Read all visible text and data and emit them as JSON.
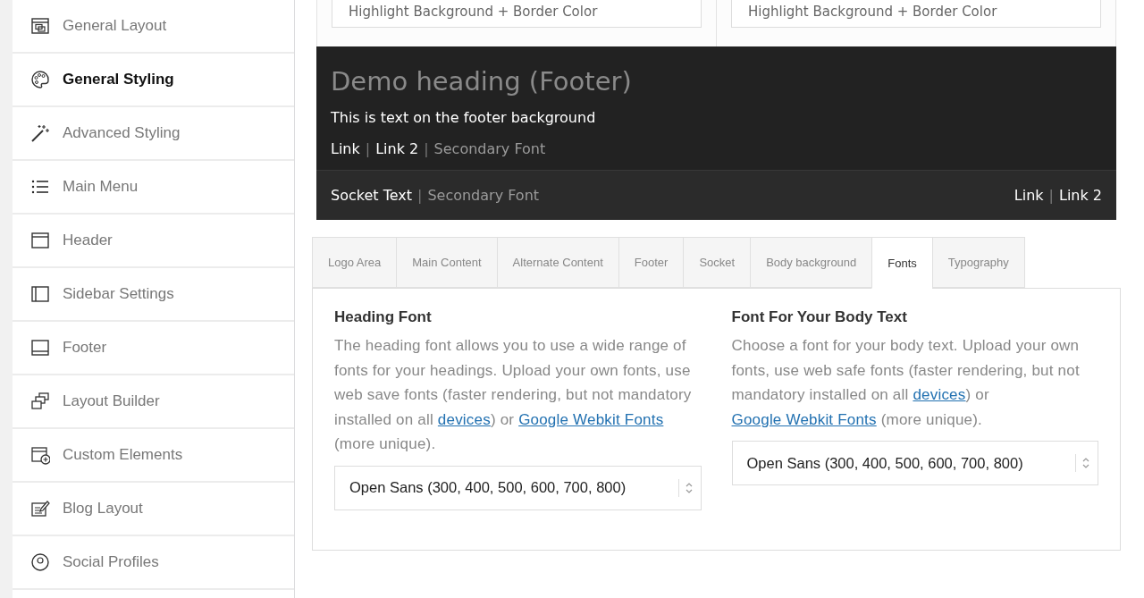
{
  "sidebar": {
    "items": [
      {
        "label": "General Layout",
        "kind": "layout",
        "selected": false
      },
      {
        "label": "General Styling",
        "kind": "palette",
        "selected": true
      },
      {
        "label": "Advanced Styling",
        "kind": "wand",
        "selected": false
      },
      {
        "label": "Main Menu",
        "kind": "list",
        "selected": false
      },
      {
        "label": "Header",
        "kind": "header",
        "selected": false
      },
      {
        "label": "Sidebar Settings",
        "kind": "sidebar",
        "selected": false
      },
      {
        "label": "Footer",
        "kind": "footer",
        "selected": false
      },
      {
        "label": "Layout Builder",
        "kind": "builder",
        "selected": false
      },
      {
        "label": "Custom Elements",
        "kind": "custom",
        "selected": false
      },
      {
        "label": "Blog Layout",
        "kind": "blog",
        "selected": false
      },
      {
        "label": "Social Profiles",
        "kind": "social",
        "selected": false
      }
    ]
  },
  "preview": {
    "highlight_boxes": [
      "Highlight Background + Border Color",
      "Highlight Background + Border Color"
    ],
    "footer": {
      "heading": "Demo heading (Footer)",
      "text": "This is text on the footer background",
      "line": [
        {
          "kind": "link",
          "text": "Link"
        },
        {
          "kind": "sep",
          "text": "|"
        },
        {
          "kind": "link",
          "text": "Link 2"
        },
        {
          "kind": "sep",
          "text": "|"
        },
        {
          "kind": "secondary",
          "text": "Secondary Font"
        }
      ]
    },
    "socket": {
      "left": [
        {
          "kind": "link",
          "text": "Socket Text"
        },
        {
          "kind": "sep",
          "text": "|"
        },
        {
          "kind": "secondary",
          "text": "Secondary Font"
        }
      ],
      "right": [
        {
          "kind": "link",
          "text": "Link"
        },
        {
          "kind": "sep",
          "text": "|"
        },
        {
          "kind": "link",
          "text": "Link 2"
        }
      ]
    }
  },
  "tabs": [
    {
      "label": "Logo Area",
      "selected": false
    },
    {
      "label": "Main Content",
      "selected": false
    },
    {
      "label": "Alternate Content",
      "selected": false
    },
    {
      "label": "Footer",
      "selected": false
    },
    {
      "label": "Socket",
      "selected": false
    },
    {
      "label": "Body background",
      "selected": false
    },
    {
      "label": "Fonts",
      "selected": true
    },
    {
      "label": "Typography",
      "selected": false
    }
  ],
  "font_settings": [
    {
      "title": "Heading Font",
      "description": [
        {
          "kind": "text",
          "text": "The heading font allows you to use a wide range of fonts for your headings. Upload your own fonts, use web save fonts (faster rendering, but not mandatory installed on all "
        },
        {
          "kind": "link",
          "text": "devices"
        },
        {
          "kind": "text",
          "text": ") or "
        },
        {
          "kind": "link",
          "text": "Google Webkit Fonts"
        },
        {
          "kind": "text",
          "text": " (more unique)."
        }
      ],
      "value": "Open Sans (300, 400, 500, 600, 700, 800)"
    },
    {
      "title": "Font For Your Body Text",
      "description": [
        {
          "kind": "text",
          "text": "Choose a font for your body text. Upload your own fonts, use web safe fonts (faster rendering, but not mandatory installed on all "
        },
        {
          "kind": "link",
          "text": "devices"
        },
        {
          "kind": "text",
          "text": ") or "
        },
        {
          "kind": "link",
          "text": "Google Webkit Fonts"
        },
        {
          "kind": "text",
          "text": " (more unique)."
        }
      ],
      "value": "Open Sans (300, 400, 500, 600, 700, 800)"
    }
  ]
}
